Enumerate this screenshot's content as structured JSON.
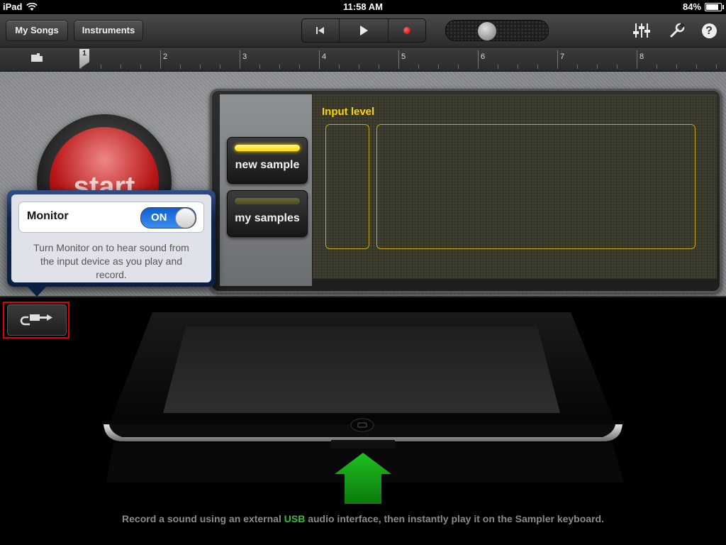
{
  "status_bar": {
    "device": "iPad",
    "time": "11:58 AM",
    "battery": "84%",
    "battery_level": 0.84
  },
  "toolbar": {
    "my_songs": "My Songs",
    "instruments": "Instruments",
    "icons": [
      "rewind-icon",
      "play-icon",
      "record-icon",
      "mixer-icon",
      "wrench-icon",
      "help-icon"
    ],
    "help_label": "?"
  },
  "ruler": {
    "bars": [
      "1",
      "2",
      "3",
      "4",
      "5",
      "6",
      "7",
      "8"
    ]
  },
  "sampler": {
    "start_label": "start",
    "input_level_label": "Input level",
    "new_sample_label": "new sample",
    "my_samples_label": "my samples",
    "led_on_color": "#ffe21a",
    "led_off_color": "#5a5a2a",
    "accent_color": "#ffd400"
  },
  "popover": {
    "monitor_label": "Monitor",
    "toggle_state": "ON",
    "description": "Turn Monitor on to hear sound from the input device as you play and record."
  },
  "caption": {
    "prefix": "Record a sound using an external ",
    "highlight": "USB",
    "suffix": " audio interface, then instantly play it on the Sampler keyboard."
  }
}
